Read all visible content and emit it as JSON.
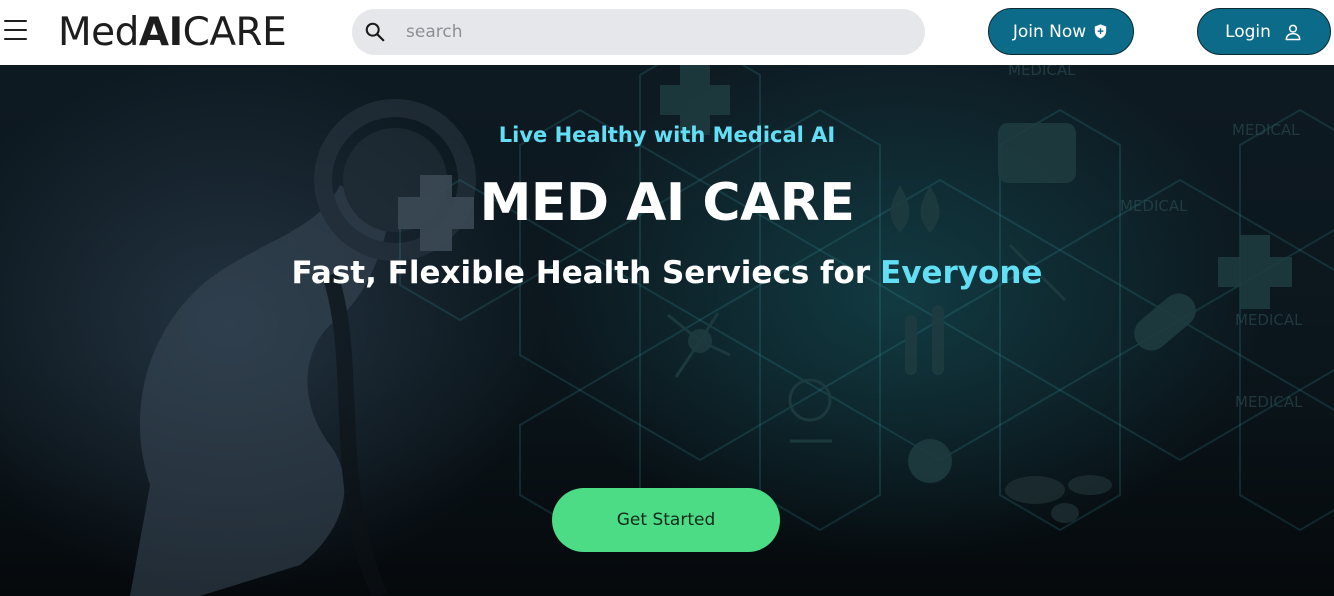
{
  "header": {
    "logo_regular": "Med",
    "logo_bold": "AI",
    "logo_tail": "CARE",
    "search_placeholder": "search",
    "join_label": "Join Now",
    "login_label": "Login"
  },
  "hero": {
    "eyebrow": "Live Healthy with Medical AI",
    "title": "MED AI CARE",
    "subtitle": "Fast, Flexible Health Serviecs for",
    "subtitle_accent": "Everyone",
    "cta_label": "Get Started"
  },
  "colors": {
    "brand_button": "#0d6b8a",
    "accent_cyan": "#63dff5",
    "cta_green": "#4cdc85",
    "search_bg": "#e6e7eb"
  },
  "icons": {
    "menu": "hamburger-icon",
    "search": "search-icon",
    "join": "shield-plus-icon",
    "login": "user-icon"
  }
}
